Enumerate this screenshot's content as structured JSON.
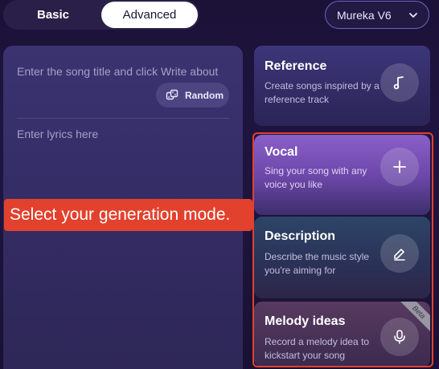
{
  "mode_toggle": {
    "basic": "Basic",
    "advanced": "Advanced",
    "selected": "Advanced"
  },
  "model_select": {
    "value": "Mureka V6"
  },
  "editor": {
    "title_placeholder": "Enter the song title and click Write about",
    "random_label": "Random",
    "lyrics_placeholder": "Enter lyrics here"
  },
  "cards": [
    {
      "title": "Reference",
      "desc": "Create songs inspired by a reference track",
      "icon": "music-note-icon"
    },
    {
      "title": "Vocal",
      "desc": "Sing your song with any voice you like",
      "icon": "plus-icon"
    },
    {
      "title": "Description",
      "desc": "Describe the music style you're aiming for",
      "icon": "pen-icon"
    },
    {
      "title": "Melody ideas",
      "desc": "Record a melody idea to kickstart your song",
      "icon": "microphone-icon",
      "badge": "Beta"
    }
  ],
  "tooltip": {
    "text": "Select your generation mode."
  },
  "colors": {
    "accent": "#6a63c9",
    "highlight": "#e2412d",
    "background": "#1c1238"
  }
}
